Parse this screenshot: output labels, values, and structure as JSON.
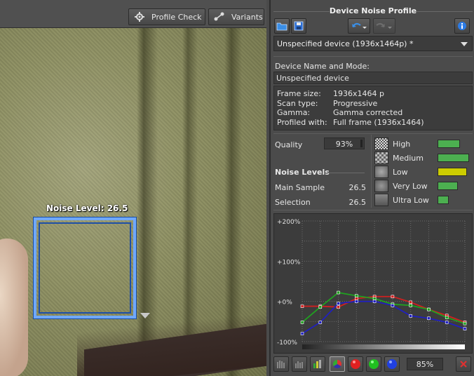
{
  "toolbar": {
    "profile_check_label": "Profile Check",
    "variants_label": "Variants"
  },
  "viewer": {
    "noise_level_label": "Noise Level: 26.5"
  },
  "panel": {
    "title": "Device Noise Profile",
    "profile_selected": "Unspecified device (1936x1464p) *",
    "device_label": "Device Name and Mode:",
    "device_name": "Unspecified device",
    "info": [
      {
        "key": "Frame size:",
        "value": "1936x1464 p"
      },
      {
        "key": "Scan type:",
        "value": "Progressive"
      },
      {
        "key": "Gamma:",
        "value": "Gamma corrected"
      },
      {
        "key": "Profiled with:",
        "value": "Full frame (1936x1464)"
      }
    ],
    "quality_label": "Quality",
    "quality_value": "93%",
    "noise_levels_title": "Noise Levels",
    "main_sample_label": "Main Sample",
    "main_sample_value": "26.5",
    "selection_label": "Selection",
    "selection_value": "26.5",
    "levels": [
      {
        "name": "High",
        "color": "#4caf50",
        "fill": 0.45
      },
      {
        "name": "Medium",
        "color": "#4caf50",
        "fill": 0.62
      },
      {
        "name": "Low",
        "color": "#cccc00",
        "fill": 0.58
      },
      {
        "name": "Very Low",
        "color": "#4caf50",
        "fill": 0.4
      },
      {
        "name": "Ultra Low",
        "color": "#4caf50",
        "fill": 0.22
      }
    ],
    "zoom_value": "85%"
  },
  "chart_data": {
    "type": "line",
    "y_tick_labels": [
      "+200%",
      "+100%",
      "+0%",
      "-100%"
    ],
    "ylim": [
      -100,
      200
    ],
    "x": [
      0,
      1,
      2,
      3,
      4,
      5,
      6,
      7,
      8,
      9
    ],
    "series": [
      {
        "color": "#d02020",
        "values": [
          -12,
          -12,
          -14,
          7,
          12,
          12,
          -2,
          -20,
          -35,
          -52
        ]
      },
      {
        "color": "#20a020",
        "values": [
          -52,
          -14,
          22,
          14,
          7,
          -7,
          -10,
          -20,
          -40,
          -55
        ]
      },
      {
        "color": "#2020c0",
        "values": [
          -80,
          -52,
          -5,
          0,
          0,
          -10,
          -36,
          -42,
          -52,
          -68
        ]
      }
    ],
    "grid": true
  }
}
